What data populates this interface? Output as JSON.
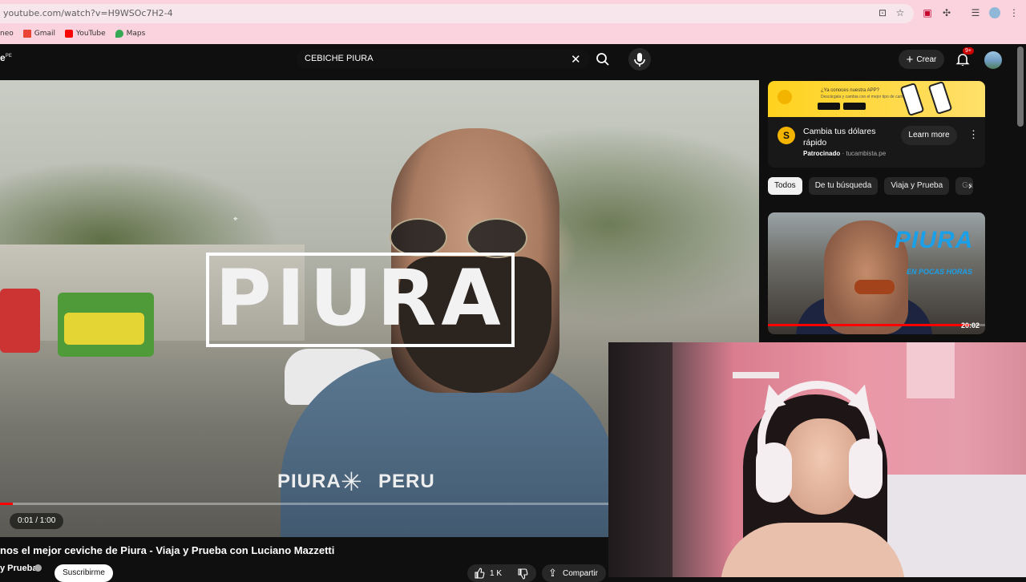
{
  "browser": {
    "url": "youtube.com/watch?v=H9WSOc7H2-4",
    "bookmarks": [
      "neo",
      "Gmail",
      "YouTube",
      "Maps"
    ]
  },
  "header": {
    "logo_fragment": "e",
    "logo_region": "PE",
    "search_value": "CEBICHE PIURA",
    "create_label": "Crear",
    "notification_badge": "9+"
  },
  "player": {
    "title_overlay": "PIURA",
    "subtitle_left": "PIURA",
    "subtitle_right": "PERU",
    "time": "0:01 / 1:00",
    "progress": 0.017
  },
  "video": {
    "title": "nos el mejor ceviche de Piura - Viaja y Prueba con Luciano Mazzetti",
    "channel": "y Prueba",
    "subscribe_label": "Suscribirme",
    "likes": "1 K",
    "share_label": "Compartir"
  },
  "ad": {
    "banner_text": "¿Ya conoces nuestra APP?",
    "banner_sub": "Descárgala y cambia con el mejor tipo de cambio",
    "title": "Cambia tus dólares rápido",
    "sponsored_label": "Patrocinado",
    "domain": "tucambista.pe",
    "cta": "Learn more",
    "logo_letter": "S"
  },
  "chips": [
    "Todos",
    "De tu búsqueda",
    "Viaja y Prueba",
    "Ga"
  ],
  "recommended": {
    "thumb_title": "PIURA",
    "thumb_subtitle": "EN POCAS HORAS",
    "duration": "20:02",
    "watched": 0.93
  },
  "colors": {
    "accent": "#ff0000",
    "bg": "#0f0f0f",
    "chrome": "#fbd3df",
    "ad_yellow": "#ffd21e"
  }
}
